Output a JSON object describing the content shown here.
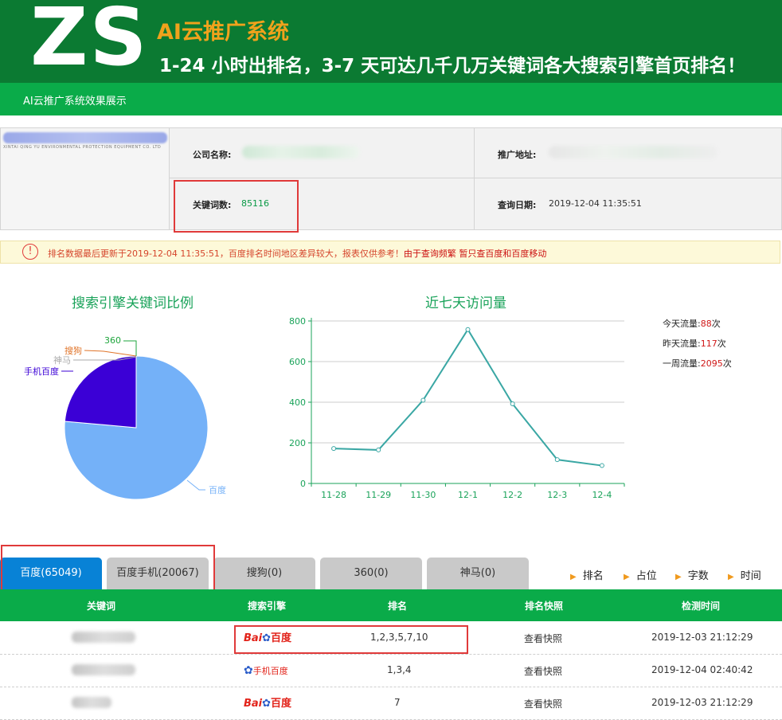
{
  "header": {
    "logo": "ZS",
    "system_title": "AI云推广系统",
    "headline": "1-24 小时出排名，3-7 天可达几千几万关键词各大搜索引擎首页排名！",
    "subtitle": "AI云推广系统效果展示"
  },
  "company_logo_caption": "XINTAI QING YU ENVIRONMENTAL PROTECTION EQUIPMENT CO. LTD",
  "info": {
    "company_label": "公司名称:",
    "url_label": "推广地址:",
    "keywords_label": "关键词数:",
    "keywords_value": "85116",
    "date_label": "查询日期:",
    "date_value": "2019-12-04 11:35:51"
  },
  "notice": {
    "icon": "exclamation-circle-icon",
    "text": "排名数据最后更新于2019-12-04 11:35:51，百度排名时间地区差异较大，报表仅供参考！",
    "warning": "由于查询频繁 暂只查百度和百度移动"
  },
  "pie_title": "搜索引擎关键词比例",
  "line_title": "近七天访问量",
  "traffic": {
    "today_label": "今天流量:",
    "today_value": "88",
    "yesterday_label": "昨天流量:",
    "yesterday_value": "117",
    "week_label": "一周流量:",
    "week_value": "2095",
    "unit": "次"
  },
  "chart_data": [
    {
      "type": "pie",
      "title": "搜索引擎关键词比例",
      "labels": [
        "百度",
        "手机百度",
        "神马",
        "搜狗",
        "360"
      ],
      "values": [
        65049,
        20067,
        0,
        0,
        0
      ],
      "colors": [
        "#74b1f8",
        "#3b00d6",
        "#aaaaaa",
        "#e0742a",
        "#1ea53c"
      ]
    },
    {
      "type": "line",
      "title": "近七天访问量",
      "categories": [
        "11-28",
        "11-29",
        "11-30",
        "12-1",
        "12-2",
        "12-3",
        "12-4"
      ],
      "values": [
        172,
        165,
        410,
        758,
        392,
        117,
        88
      ],
      "ylim": [
        0,
        800
      ],
      "yticks": [
        "0",
        "200",
        "400",
        "600",
        "800"
      ],
      "grid": true,
      "color": "#3aa7a4"
    }
  ],
  "tabs": [
    {
      "label": "百度(65049)",
      "active": true
    },
    {
      "label": "百度手机(20067)",
      "active": false
    },
    {
      "label": "搜狗(0)",
      "active": false
    },
    {
      "label": "360(0)",
      "active": false
    },
    {
      "label": "神马(0)",
      "active": false
    }
  ],
  "sort_options": [
    "排名",
    "占位",
    "字数",
    "时间"
  ],
  "table": {
    "headers": [
      "关键词",
      "搜索引擎",
      "排名",
      "排名快照",
      "检测时间"
    ],
    "rows": [
      {
        "engine": "百度",
        "rank": "1,2,3,5,7,10",
        "snapshot": "查看快照",
        "time": "2019-12-03 21:12:29"
      },
      {
        "engine": "手机百度",
        "rank": "1,3,4",
        "snapshot": "查看快照",
        "time": "2019-12-04 02:40:42"
      },
      {
        "engine": "百度",
        "rank": "7",
        "snapshot": "查看快照",
        "time": "2019-12-03 21:12:29"
      }
    ]
  },
  "engine_logo_text": {
    "bai": "Bai",
    "du": "百度",
    "mobile": "手机百度"
  }
}
